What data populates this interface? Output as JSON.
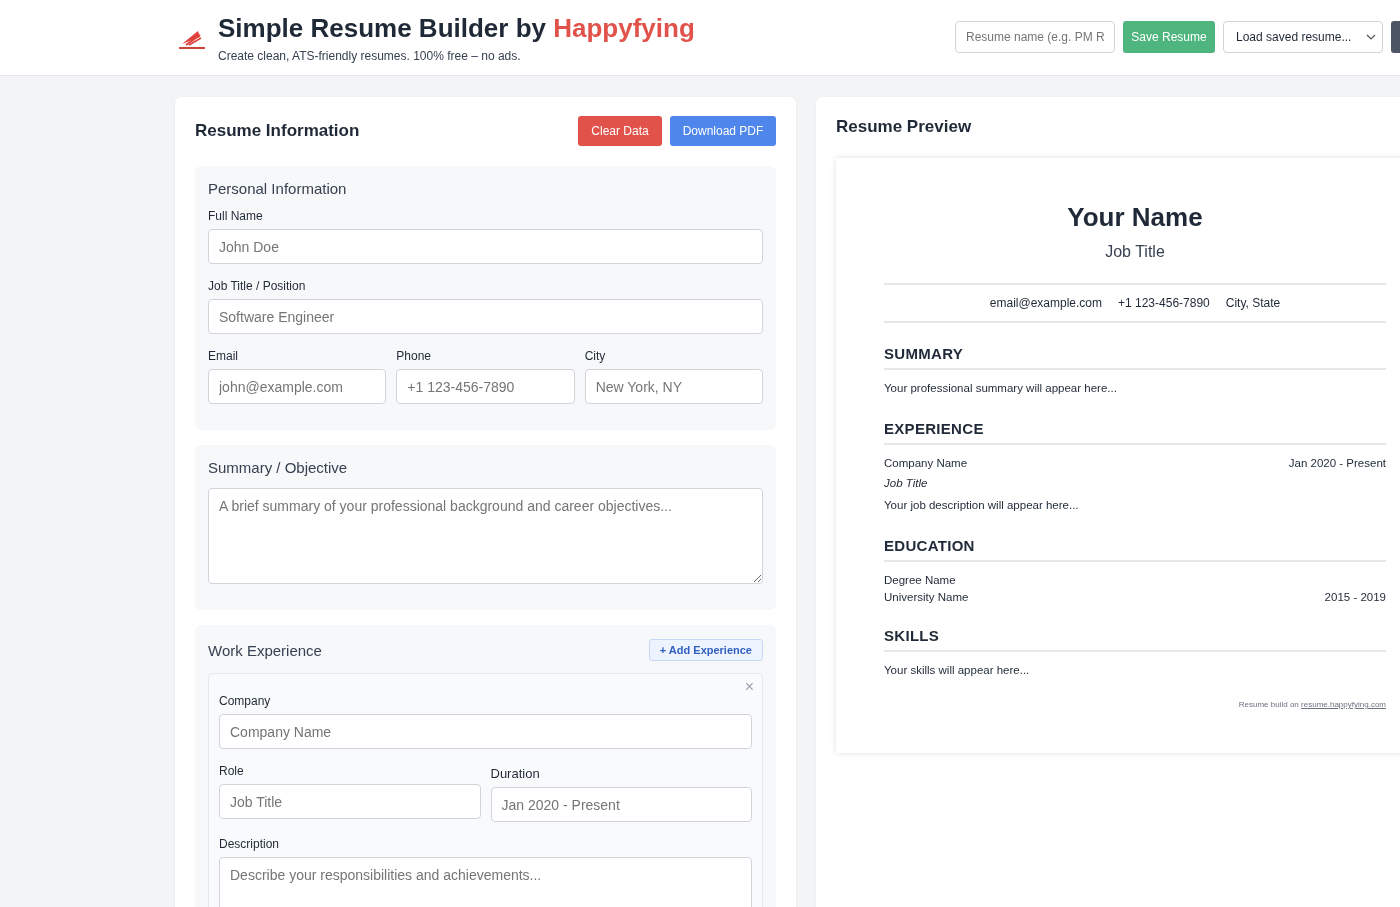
{
  "header": {
    "title": "Simple Resume Builder by",
    "brand": "Happyfying",
    "tagline": "Create clean, ATS-friendly resumes. 100% free – no ads.",
    "resume_name": {
      "placeholder": "Resume name (e.g. PM R"
    },
    "save_button": "Save Resume",
    "load_select": {
      "value": "Load saved resume..."
    }
  },
  "form": {
    "title": "Resume Information",
    "buttons": [
      {
        "label": "Clear Data",
        "kind": "danger"
      },
      {
        "label": "Download PDF",
        "kind": "primary"
      }
    ],
    "personal": {
      "title": "Personal Information",
      "full_name": {
        "label": "Full Name",
        "placeholder": "John Doe"
      },
      "job_title": {
        "label": "Job Title / Position",
        "placeholder": "Software Engineer"
      },
      "contact_fields": [
        {
          "label": "Email",
          "placeholder": "john@example.com"
        },
        {
          "label": "Phone",
          "placeholder": "+1 123-456-7890"
        },
        {
          "label": "City",
          "placeholder": "New York, NY"
        }
      ]
    },
    "summary": {
      "title": "Summary / Objective",
      "placeholder": "A brief summary of your professional background and career objectives..."
    },
    "experience": {
      "title": "Work Experience",
      "add_button": "+ Add Experience",
      "remove": "×",
      "company": {
        "label": "Company",
        "placeholder": "Company Name"
      },
      "role": {
        "label": "Role",
        "placeholder": "Job Title"
      },
      "duration": {
        "label": "Duration",
        "placeholder": "Jan 2020 - Present"
      },
      "description": {
        "label": "Description",
        "placeholder": "Describe your responsibilities and achievements..."
      }
    }
  },
  "preview": {
    "title": "Resume Preview",
    "name": "Your Name",
    "job_title": "Job Title",
    "contact": [
      "email@example.com",
      "+1 123-456-7890",
      "City, State"
    ],
    "summary": {
      "heading": "SUMMARY",
      "text": "Your professional summary will appear here..."
    },
    "experience": {
      "heading": "EXPERIENCE",
      "company": "Company Name",
      "dates": "Jan 2020 - Present",
      "role": "Job Title",
      "description": "Your job description will appear here..."
    },
    "education": {
      "heading": "EDUCATION",
      "degree": "Degree Name",
      "school": "University Name",
      "years": "2015 - 2019"
    },
    "skills": {
      "heading": "SKILLS",
      "text": "Your skills will appear here..."
    },
    "footer": {
      "text": "Resume build on",
      "link": "resume.happyfying.com"
    }
  }
}
